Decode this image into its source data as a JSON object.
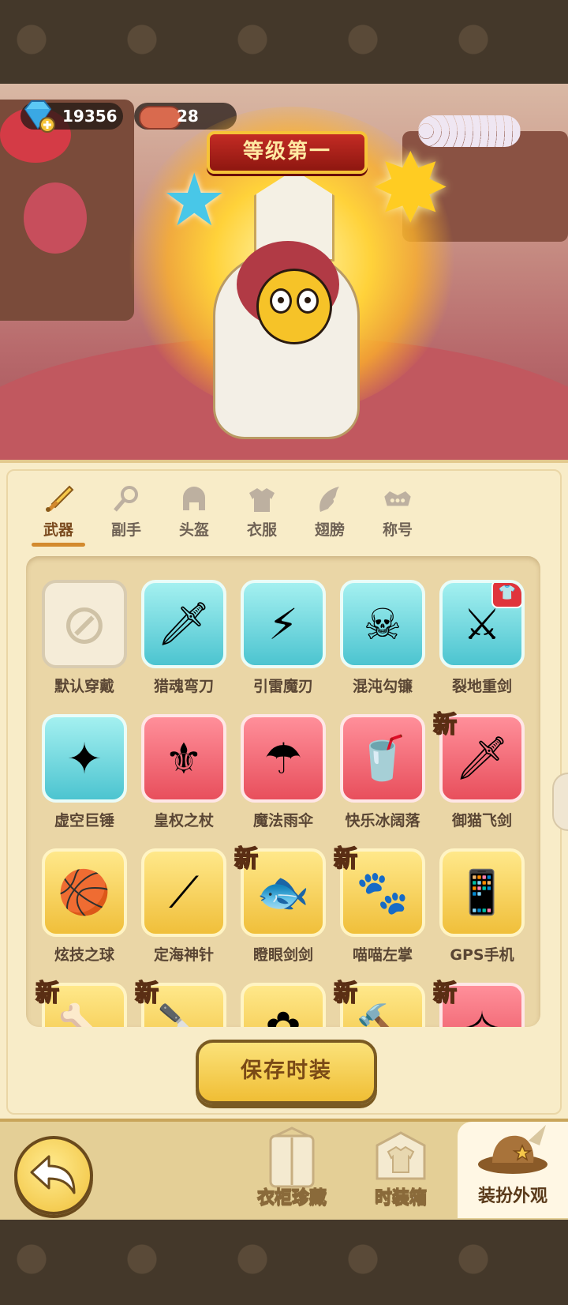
{
  "currency": {
    "gems": "19356",
    "meat": "28"
  },
  "hero": {
    "rank_banner": "等级第一"
  },
  "tabs": [
    {
      "label": "武器",
      "icon": "sword-icon",
      "active": true
    },
    {
      "label": "副手",
      "icon": "offhand-icon",
      "active": false
    },
    {
      "label": "头盔",
      "icon": "helmet-icon",
      "active": false
    },
    {
      "label": "衣服",
      "icon": "armor-icon",
      "active": false
    },
    {
      "label": "翅膀",
      "icon": "wing-icon",
      "active": false
    },
    {
      "label": "称号",
      "icon": "title-icon",
      "active": false
    }
  ],
  "items": [
    {
      "name": "默认穿戴",
      "rarity": "none",
      "glyph": "⊘",
      "new": false,
      "equipped": false
    },
    {
      "name": "猎魂弯刀",
      "rarity": "cyan",
      "glyph": "🗡",
      "new": false,
      "equipped": false
    },
    {
      "name": "引雷魔刃",
      "rarity": "cyan",
      "glyph": "⚡",
      "new": false,
      "equipped": false
    },
    {
      "name": "混沌勾镰",
      "rarity": "cyan",
      "glyph": "☠",
      "new": false,
      "equipped": false
    },
    {
      "name": "裂地重剑",
      "rarity": "cyan",
      "glyph": "⚔",
      "new": false,
      "equipped": true
    },
    {
      "name": "虚空巨锤",
      "rarity": "cyan",
      "glyph": "✦",
      "new": false,
      "equipped": false
    },
    {
      "name": "皇权之杖",
      "rarity": "red",
      "glyph": "⚜",
      "new": false,
      "equipped": false
    },
    {
      "name": "魔法雨伞",
      "rarity": "red",
      "glyph": "☂",
      "new": false,
      "equipped": false
    },
    {
      "name": "快乐冰阔落",
      "rarity": "red",
      "glyph": "🥤",
      "new": false,
      "equipped": false
    },
    {
      "name": "御猫飞剑",
      "rarity": "red",
      "glyph": "🗡",
      "new": true,
      "equipped": false
    },
    {
      "name": "炫技之球",
      "rarity": "gold",
      "glyph": "🏀",
      "new": false,
      "equipped": false
    },
    {
      "name": "定海神针",
      "rarity": "gold",
      "glyph": "⟋",
      "new": false,
      "equipped": false
    },
    {
      "name": "瞪眼剑剑",
      "rarity": "gold",
      "glyph": "🐟",
      "new": true,
      "equipped": false
    },
    {
      "name": "喵喵左掌",
      "rarity": "gold",
      "glyph": "🐾",
      "new": true,
      "equipped": false
    },
    {
      "name": "GPS手机",
      "rarity": "gold",
      "glyph": "📱",
      "new": false,
      "equipped": false
    },
    {
      "name": "",
      "rarity": "gold",
      "glyph": "🦴",
      "new": true,
      "equipped": false
    },
    {
      "name": "",
      "rarity": "gold",
      "glyph": "🔪",
      "new": true,
      "equipped": false
    },
    {
      "name": "",
      "rarity": "gold",
      "glyph": "✿",
      "new": false,
      "equipped": false
    },
    {
      "name": "",
      "rarity": "gold",
      "glyph": "🔨",
      "new": true,
      "equipped": false
    },
    {
      "name": "",
      "rarity": "red",
      "glyph": "✧",
      "new": true,
      "equipped": false
    }
  ],
  "new_tag": "新",
  "save_button": "保存时装",
  "bottom_nav": {
    "wardrobe": "衣柜珍藏",
    "fashion_box": "时装箱",
    "dress_up": "装扮外观"
  },
  "colors": {
    "panel_bg": "#f8ecc8",
    "active_tab_underline": "#d38a2e",
    "button_gold": "#f0be35"
  }
}
